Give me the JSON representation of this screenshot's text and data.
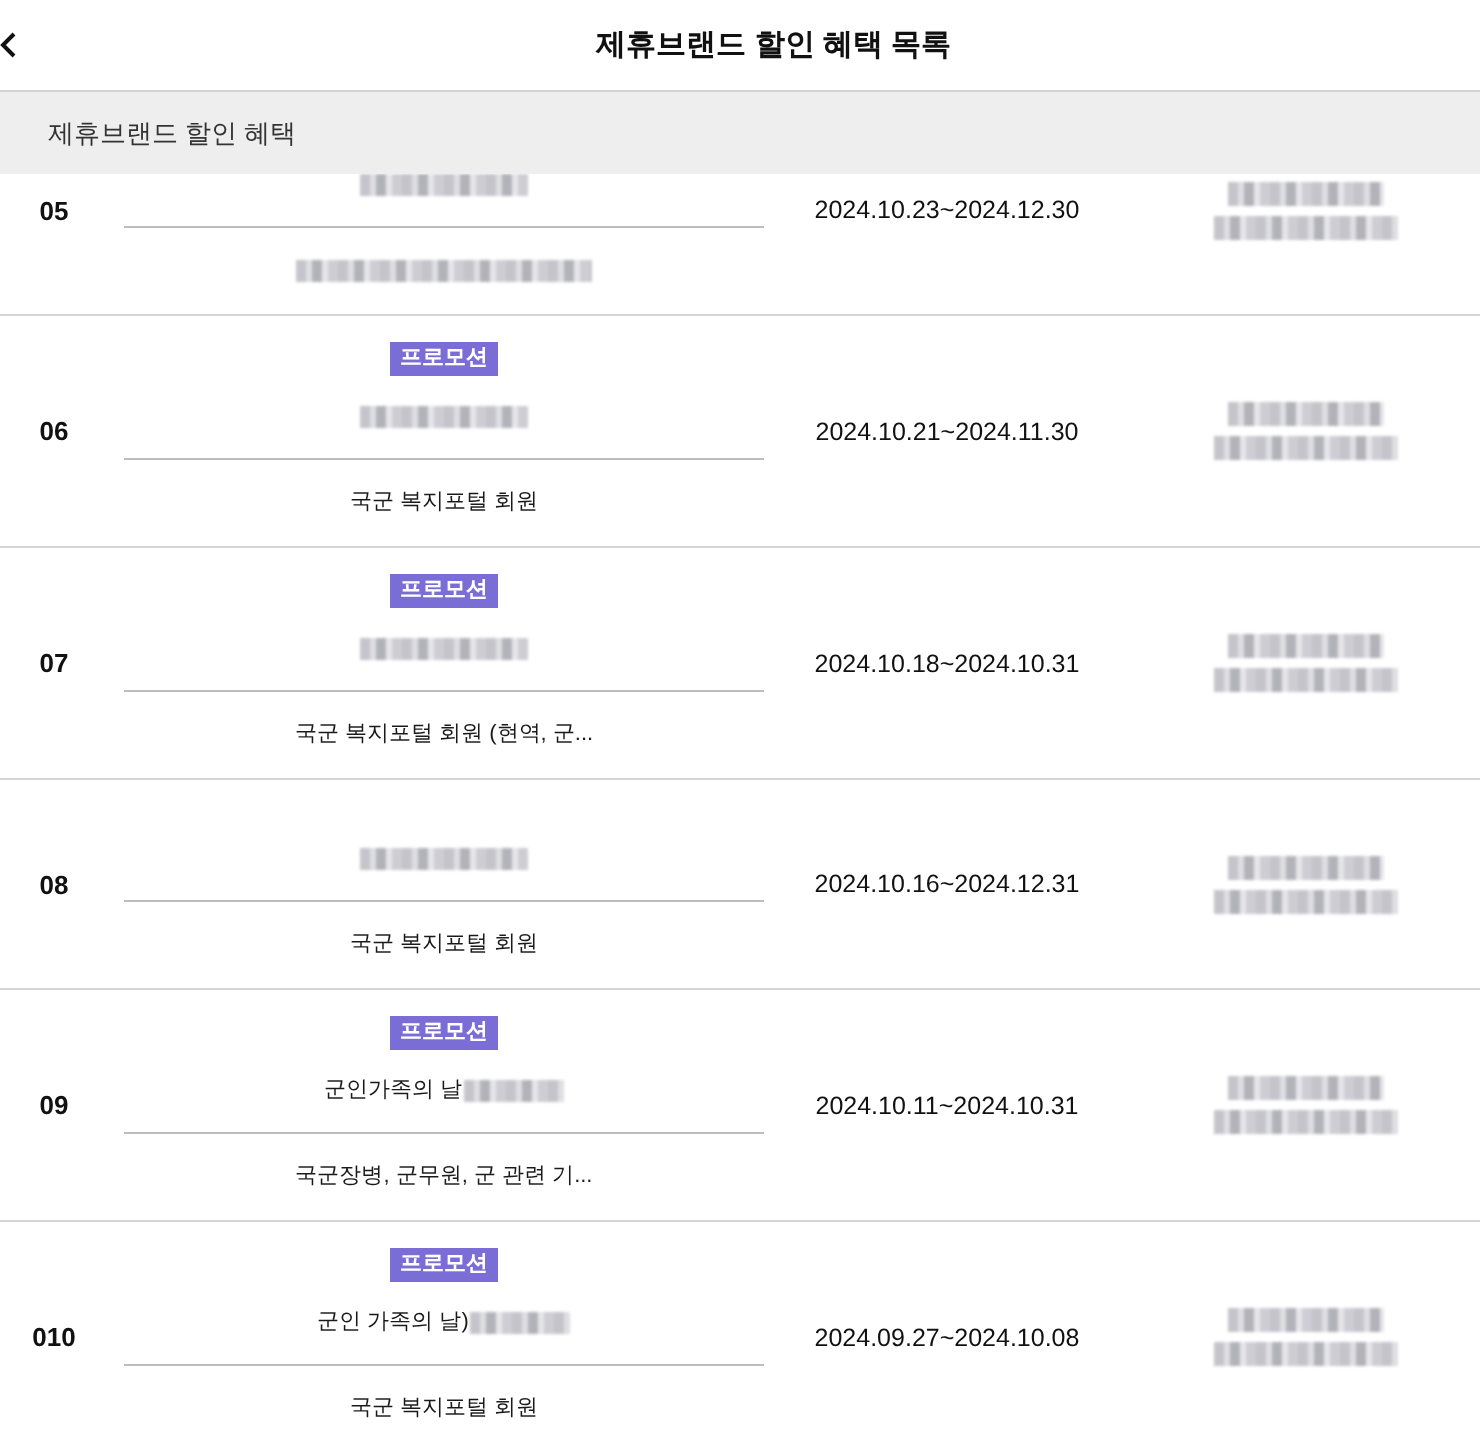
{
  "header": {
    "title": "제휴브랜드 할인 혜택 목록"
  },
  "section": {
    "title": "제휴브랜드 할인 혜택"
  },
  "rows": [
    {
      "number": "05",
      "brand": [
        {
          "kind": "redacted"
        }
      ],
      "eligibility": [
        {
          "kind": "redacted"
        }
      ],
      "period": "2024.10.23~2024.12.30",
      "contact": [
        {
          "kind": "redacted"
        },
        {
          "kind": "redacted"
        }
      ]
    },
    {
      "number": "06",
      "badge": "프로모션",
      "brand": [
        {
          "kind": "redacted"
        }
      ],
      "eligibility": [
        {
          "kind": "text",
          "text": "국군 복지포털 회원"
        }
      ],
      "period": "2024.10.21~2024.11.30",
      "contact": [
        {
          "kind": "redacted"
        },
        {
          "kind": "redacted"
        }
      ]
    },
    {
      "number": "07",
      "badge": "프로모션",
      "brand": [
        {
          "kind": "redacted"
        }
      ],
      "eligibility": [
        {
          "kind": "text",
          "text": "국군 복지포털 회원 (현역, 군..."
        }
      ],
      "period": "2024.10.18~2024.10.31",
      "contact": [
        {
          "kind": "redacted"
        },
        {
          "kind": "redacted"
        }
      ]
    },
    {
      "number": "08",
      "brand": [
        {
          "kind": "redacted"
        }
      ],
      "eligibility": [
        {
          "kind": "text",
          "text": "국군 복지포털 회원"
        }
      ],
      "period": "2024.10.16~2024.12.31",
      "contact": [
        {
          "kind": "redacted"
        },
        {
          "kind": "redacted"
        }
      ]
    },
    {
      "number": "09",
      "badge": "프로모션",
      "brand": [
        {
          "kind": "text",
          "text": "군인가족의 날"
        },
        {
          "kind": "redacted"
        }
      ],
      "eligibility": [
        {
          "kind": "text",
          "text": "국군장병, 군무원, 군 관련 기..."
        }
      ],
      "period": "2024.10.11~2024.10.31",
      "contact": [
        {
          "kind": "redacted"
        },
        {
          "kind": "redacted"
        }
      ]
    },
    {
      "number": "010",
      "badge": "프로모션",
      "brand": [
        {
          "kind": "text",
          "text": "군인 가족의 날)"
        },
        {
          "kind": "redacted"
        }
      ],
      "eligibility": [
        {
          "kind": "text",
          "text": "국군 복지포털 회원"
        }
      ],
      "period": "2024.09.27~2024.10.08",
      "contact": [
        {
          "kind": "redacted"
        },
        {
          "kind": "redacted"
        }
      ]
    }
  ]
}
